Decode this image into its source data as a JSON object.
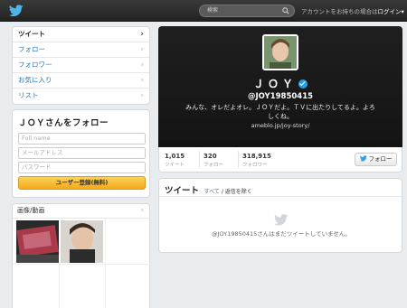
{
  "topbar": {
    "search_placeholder": "検索",
    "login_prefix": "アカウントをお持ちの場合は",
    "login_link": "ログイン",
    "login_caret": "▾"
  },
  "nav": {
    "items": [
      {
        "label": "ツイート",
        "active": true
      },
      {
        "label": "フォロー"
      },
      {
        "label": "フォロワー"
      },
      {
        "label": "お気に入り"
      },
      {
        "label": "リスト"
      }
    ],
    "chevron": "›"
  },
  "signup": {
    "title": "ＪＯＹさんをフォロー",
    "fullname_placeholder": "Full name",
    "email_placeholder": "メールアドレス",
    "password_placeholder": "パスワード",
    "button": "ユーザー登録(無料)"
  },
  "media": {
    "title": "画像/動画"
  },
  "profile": {
    "name": "ＪＯＹ",
    "handle": "@JOY19850415",
    "bio": "みんな、オレだよオレ。ＪＯＹだよ。ＴＶに出たりしてるよ。よろしくね。",
    "url": "ameblo.jp/joy-story/"
  },
  "stats": {
    "tweets": {
      "value": "1,015",
      "label": "ツイート"
    },
    "following": {
      "value": "320",
      "label": "フォロー"
    },
    "followers": {
      "value": "318,915",
      "label": "フォロワー"
    },
    "follow_button": "フォロー"
  },
  "timeline": {
    "title": "ツイート",
    "filter_all": "すべて",
    "filter_sep": "/",
    "filter_no_replies": "返信を除く",
    "empty_message": "@JOY19850415さんはまだツイートしていません。"
  },
  "colors": {
    "accent": "#2b7bb9",
    "signup_button": "#f4a91c",
    "verified": "#2b9fe3"
  }
}
